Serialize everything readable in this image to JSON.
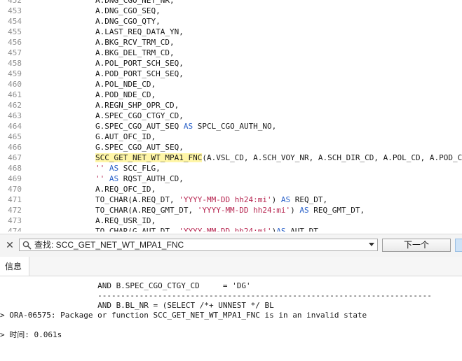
{
  "editor": {
    "lines": [
      {
        "n": "452",
        "segs": [
          {
            "t": "A.DNG_CGO_NET_NR,",
            "c": ""
          }
        ]
      },
      {
        "n": "453",
        "segs": [
          {
            "t": "A.DNG_CGO_SEQ,",
            "c": ""
          }
        ]
      },
      {
        "n": "454",
        "segs": [
          {
            "t": "A.DNG_CGO_QTY,",
            "c": ""
          }
        ]
      },
      {
        "n": "455",
        "segs": [
          {
            "t": "A.LAST_REQ_DATA_YN,",
            "c": ""
          }
        ]
      },
      {
        "n": "456",
        "segs": [
          {
            "t": "A.BKG_RCV_TRM_CD,",
            "c": ""
          }
        ]
      },
      {
        "n": "457",
        "segs": [
          {
            "t": "A.BKG_DEL_TRM_CD,",
            "c": ""
          }
        ]
      },
      {
        "n": "458",
        "segs": [
          {
            "t": "A.POL_PORT_SCH_SEQ,",
            "c": ""
          }
        ]
      },
      {
        "n": "459",
        "segs": [
          {
            "t": "A.POD_PORT_SCH_SEQ,",
            "c": ""
          }
        ]
      },
      {
        "n": "460",
        "segs": [
          {
            "t": "A.POL_NDE_CD,",
            "c": ""
          }
        ]
      },
      {
        "n": "461",
        "segs": [
          {
            "t": "A.POD_NDE_CD,",
            "c": ""
          }
        ]
      },
      {
        "n": "462",
        "segs": [
          {
            "t": "A.REGN_SHP_OPR_CD,",
            "c": ""
          }
        ]
      },
      {
        "n": "463",
        "segs": [
          {
            "t": "A.SPEC_CGO_CTGY_CD,",
            "c": ""
          }
        ]
      },
      {
        "n": "464",
        "segs": [
          {
            "t": "G.SPEC_CGO_AUT_SEQ ",
            "c": ""
          },
          {
            "t": "AS",
            "c": "kw"
          },
          {
            "t": " SPCL_CGO_AUTH_NO,",
            "c": ""
          }
        ]
      },
      {
        "n": "465",
        "segs": [
          {
            "t": "G.AUT_OFC_ID,",
            "c": ""
          }
        ]
      },
      {
        "n": "466",
        "segs": [
          {
            "t": "G.SPEC_CGO_AUT_SEQ,",
            "c": ""
          }
        ]
      },
      {
        "n": "467",
        "segs": [
          {
            "t": "SCC_GET_NET_WT_MPA1_FNC",
            "c": "hl"
          },
          {
            "t": "(A.VSL_CD, A.SCH_VOY_NR, A.SCH_DIR_CD, A.POL_CD, A.POD_CD",
            "c": ""
          }
        ]
      },
      {
        "n": "468",
        "segs": [
          {
            "t": "''",
            "c": "str"
          },
          {
            "t": " ",
            "c": ""
          },
          {
            "t": "AS",
            "c": "kw"
          },
          {
            "t": " SCC_FLG,",
            "c": ""
          }
        ]
      },
      {
        "n": "469",
        "segs": [
          {
            "t": "''",
            "c": "str"
          },
          {
            "t": " ",
            "c": ""
          },
          {
            "t": "AS",
            "c": "kw"
          },
          {
            "t": " RQST_AUTH_CD,",
            "c": ""
          }
        ]
      },
      {
        "n": "470",
        "segs": [
          {
            "t": "A.REQ_OFC_ID,",
            "c": ""
          }
        ]
      },
      {
        "n": "471",
        "segs": [
          {
            "t": "TO_CHAR(A.REQ_DT, ",
            "c": ""
          },
          {
            "t": "'YYYY-MM-DD hh24:mi'",
            "c": "str"
          },
          {
            "t": ") ",
            "c": ""
          },
          {
            "t": "AS",
            "c": "kw"
          },
          {
            "t": " REQ_DT,",
            "c": ""
          }
        ]
      },
      {
        "n": "472",
        "segs": [
          {
            "t": "TO_CHAR(A.REQ_GMT_DT, ",
            "c": ""
          },
          {
            "t": "'YYYY-MM-DD hh24:mi'",
            "c": "str"
          },
          {
            "t": ") ",
            "c": ""
          },
          {
            "t": "AS",
            "c": "kw"
          },
          {
            "t": " REQ_GMT_DT,",
            "c": ""
          }
        ]
      },
      {
        "n": "473",
        "segs": [
          {
            "t": "A.REQ_USR_ID,",
            "c": ""
          }
        ]
      },
      {
        "n": "474",
        "segs": [
          {
            "t": "TO_CHAR(G.AUT_DT, ",
            "c": ""
          },
          {
            "t": "'YYYY-MM-DD hh24:mi'",
            "c": "str"
          },
          {
            "t": ")",
            "c": ""
          },
          {
            "t": "AS",
            "c": "kw"
          },
          {
            "t": " AUT_DT,",
            "c": ""
          }
        ]
      }
    ]
  },
  "find_bar": {
    "label": "查找: SCC_GET_NET_WT_MPA1_FNC",
    "next_label": "下一个"
  },
  "messages": {
    "tab_label": "信息",
    "lines": [
      "                     AND B.SPEC_CGO_CTGY_CD     = 'DG'",
      "                     ------------------------------------------------------------------------",
      "                     AND B.BL_NR = (SELECT /*+ UNNEST */ BL",
      "> ORA-06575: Package or function SCC_GET_NET_WT_MPA1_FNC is in an invalid state",
      "",
      "> 时间: 0.061s"
    ]
  },
  "colors": {
    "keyword": "#2b62c9",
    "string": "#b6244f",
    "highlight": "#fff6a8",
    "line_number": "#8f8f8f"
  }
}
